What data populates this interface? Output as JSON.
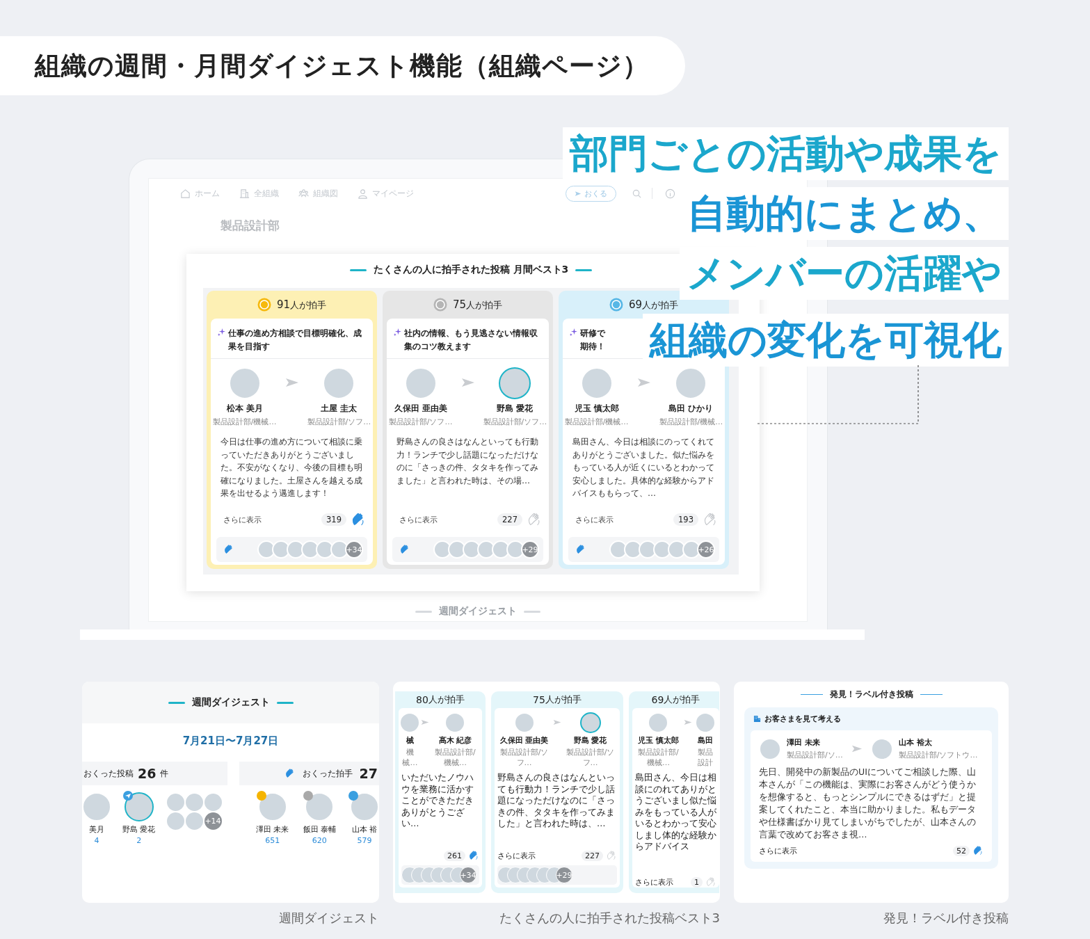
{
  "page_title": "組織の週間・月間ダイジェスト機能（組織ページ）",
  "headline": [
    "部門ごとの活動や成果を",
    "自動的にまとめ、",
    "メンバーの活躍や",
    "組織の変化を可視化"
  ],
  "laptop": {
    "nav": {
      "items": [
        "ホーム",
        "全組織",
        "組織図",
        "マイページ"
      ],
      "send_button": "おくる"
    },
    "org_name": "製品設計部",
    "modal": {
      "title": "たくさんの人に拍手された投稿 月間ベスト3",
      "cards": [
        {
          "color": "#fdf0b4",
          "clappers": "91",
          "clappers_unit": "人が拍手",
          "title": "仕事の進め方相談で目標明確化、成果を目指す",
          "from": {
            "name": "松本 美月",
            "dept": "製品設計部/機械…",
            "highlighted": false
          },
          "to": {
            "name": "土屋 圭太",
            "dept": "製品設計部/ソフ…",
            "highlighted": false
          },
          "body": "今日は仕事の進め方について相談に乗っていただきありがとうございました。不安がなくなり、今後の目標も明確になりました。土屋さんを越える成果を出せるよう邁進します！",
          "more": "さらに表示",
          "count": "319",
          "clapped": true,
          "stack_more": "+34"
        },
        {
          "color": "#e6e6e6",
          "clappers": "75",
          "clappers_unit": "人が拍手",
          "title": "社内の情報、もう見逃さない情報収集のコツ教えます",
          "from": {
            "name": "久保田 亜由美",
            "dept": "製品設計部/ソフ…",
            "highlighted": false
          },
          "to": {
            "name": "野島 愛花",
            "dept": "製品設計部/ソフ…",
            "highlighted": true
          },
          "body": "野島さんの良さはなんといっても行動力！ランチで少し話題になっただけなのに「さっきの件、タタキを作ってみました」と言われた時は、その場…",
          "more": "さらに表示",
          "count": "227",
          "clapped": false,
          "stack_more": "+29"
        },
        {
          "color": "#d8f0fa",
          "clappers": "69",
          "clappers_unit": "人が拍手",
          "title": "研修で期待！",
          "from": {
            "name": "児玉 慎太郎",
            "dept": "製品設計部/機械…",
            "highlighted": false
          },
          "to": {
            "name": "島田 ひかり",
            "dept": "製品設計部/機械…",
            "highlighted": false
          },
          "body": "島田さん、今日は相談にのってくれてありがとうございました。似た悩みをもっている人が近くにいるとわかって安心しました。具体的な経験からアドバイスももらって、…",
          "more": "さらに表示",
          "count": "193",
          "clapped": false,
          "stack_more": "+26"
        }
      ]
    },
    "next_section": "週間ダイジェスト"
  },
  "previews": [
    {
      "kind": "digest",
      "caption": "週間ダイジェスト",
      "title": "週間ダイジェスト",
      "date": "7月21日〜7月27日",
      "stats": [
        {
          "label": "おくった投稿",
          "value": "26",
          "unit": "件"
        },
        {
          "label": "おくった拍手",
          "value": "27"
        }
      ],
      "posters": [
        {
          "name": "美月",
          "count": "4",
          "highlighted": false
        },
        {
          "name": "野島 愛花",
          "count": "2",
          "highlighted": true
        }
      ],
      "poster_more": "+14",
      "clappers": [
        {
          "name": "澤田 未来",
          "count": "651",
          "color": "#f5b400"
        },
        {
          "name": "飯田 泰輔",
          "count": "620",
          "color": "#a9a9a9"
        },
        {
          "name": "山本 裕",
          "count": "579",
          "color": "#3a9fe0"
        }
      ]
    },
    {
      "kind": "best3",
      "caption": "たくさんの人に拍手された投稿ベスト3",
      "cards": [
        {
          "clappers": "80",
          "clappers_unit": "人が拍手",
          "from": {
            "name": "械",
            "dept": "機械…",
            "highlighted": false
          },
          "to": {
            "name": "髙木 紀彦",
            "dept": "製品設計部/機械…",
            "highlighted": false
          },
          "body": "いただいたノウハウを業務に活かすことができただきありがとうござい…",
          "count": "261",
          "clapped": true,
          "stack_more": "+34"
        },
        {
          "clappers": "75",
          "clappers_unit": "人が拍手",
          "from": {
            "name": "久保田 亜由美",
            "dept": "製品設計部/ソフ…",
            "highlighted": false
          },
          "to": {
            "name": "野島 愛花",
            "dept": "製品設計部/ソフ…",
            "highlighted": true
          },
          "body": "野島さんの良さはなんといっても行動力！ランチで少し話題になっただけなのに「さっきの件、タタキを作ってみました」と言われた時は、…",
          "more": "さらに表示",
          "count": "227",
          "clapped": false,
          "stack_more": "+29"
        },
        {
          "clappers": "69",
          "clappers_unit": "人が拍手",
          "from": {
            "name": "児玉 慎太郎",
            "dept": "製品設計部/機械…",
            "highlighted": false
          },
          "to": {
            "name": "島田",
            "dept": "製品設計",
            "highlighted": false
          },
          "body": "島田さん、今日は相談にのれてありがとうございまし似た悩みをもっている人がいるとわかって安心しまし体的な経験からアドバイス",
          "more": "さらに表示",
          "count": "1",
          "clapped": false
        }
      ]
    },
    {
      "kind": "labeled",
      "caption": "発見！ラベル付き投稿",
      "title": "発見！ラベル付き投稿",
      "label": "お客さまを見て考える",
      "from": {
        "name": "澤田 未来",
        "dept": "製品設計部/ソ…",
        "highlighted": false
      },
      "to": {
        "name": "山本 裕太",
        "dept": "製品設計部/ソフトウ…",
        "highlighted": false
      },
      "body": "先日、開発中の新製品のUIについてご相談した際、山本さんが「この機能は、実際にお客さんがどう使うかを想像すると、もっとシンプルにできるはずだ」と提案してくれたこと、本当に助かりました。私もデータや仕様書ばかり見てしまいがちでしたが、山本さんの言葉で改めてお客さま視…",
      "more": "さらに表示",
      "count": "52",
      "clapped": true
    }
  ]
}
